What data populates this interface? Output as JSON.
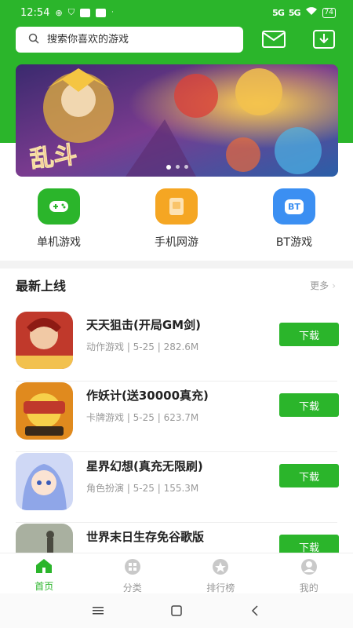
{
  "status_bar": {
    "time": "12:54",
    "signal1": "5G",
    "signal2": "5G",
    "battery": "74"
  },
  "search": {
    "placeholder": "搜索你喜欢的游戏"
  },
  "banner": {
    "title": "乱斗"
  },
  "categories": [
    {
      "label": "单机游戏",
      "icon": "gamepad-icon",
      "color": "#2bb52b"
    },
    {
      "label": "手机网游",
      "icon": "phone-game-icon",
      "color": "#f5a623"
    },
    {
      "label": "BT游戏",
      "icon": "bt-icon",
      "color": "#3b8ff2",
      "icon_text": "BT"
    }
  ],
  "section": {
    "title": "最新上线",
    "more": "更多"
  },
  "games": [
    {
      "name": "天天狙击(开局GM剑)",
      "meta": "动作游戏 | 5-25 | 282.6M",
      "button": "下载",
      "thumb_color": "#c0392b"
    },
    {
      "name": "作妖计(送30000真充)",
      "meta": "卡牌游戏 | 5-25 | 623.7M",
      "button": "下载",
      "thumb_color": "#e08a1e"
    },
    {
      "name": "星界幻想(真充无限刷)",
      "meta": "角色扮演 | 5-25 | 155.3M",
      "button": "下载",
      "thumb_color": "#7a8fd6"
    },
    {
      "name": "世界末日生存免谷歌版",
      "meta": "",
      "button": "下载",
      "thumb_color": "#7d8a6a"
    }
  ],
  "tabs": [
    {
      "label": "首页",
      "icon": "home-icon",
      "active": true
    },
    {
      "label": "分类",
      "icon": "grid-icon",
      "active": false
    },
    {
      "label": "排行榜",
      "icon": "rank-icon",
      "active": false
    },
    {
      "label": "我的",
      "icon": "user-icon",
      "active": false
    }
  ],
  "colors": {
    "brand": "#2bb52b",
    "muted": "#999999"
  }
}
